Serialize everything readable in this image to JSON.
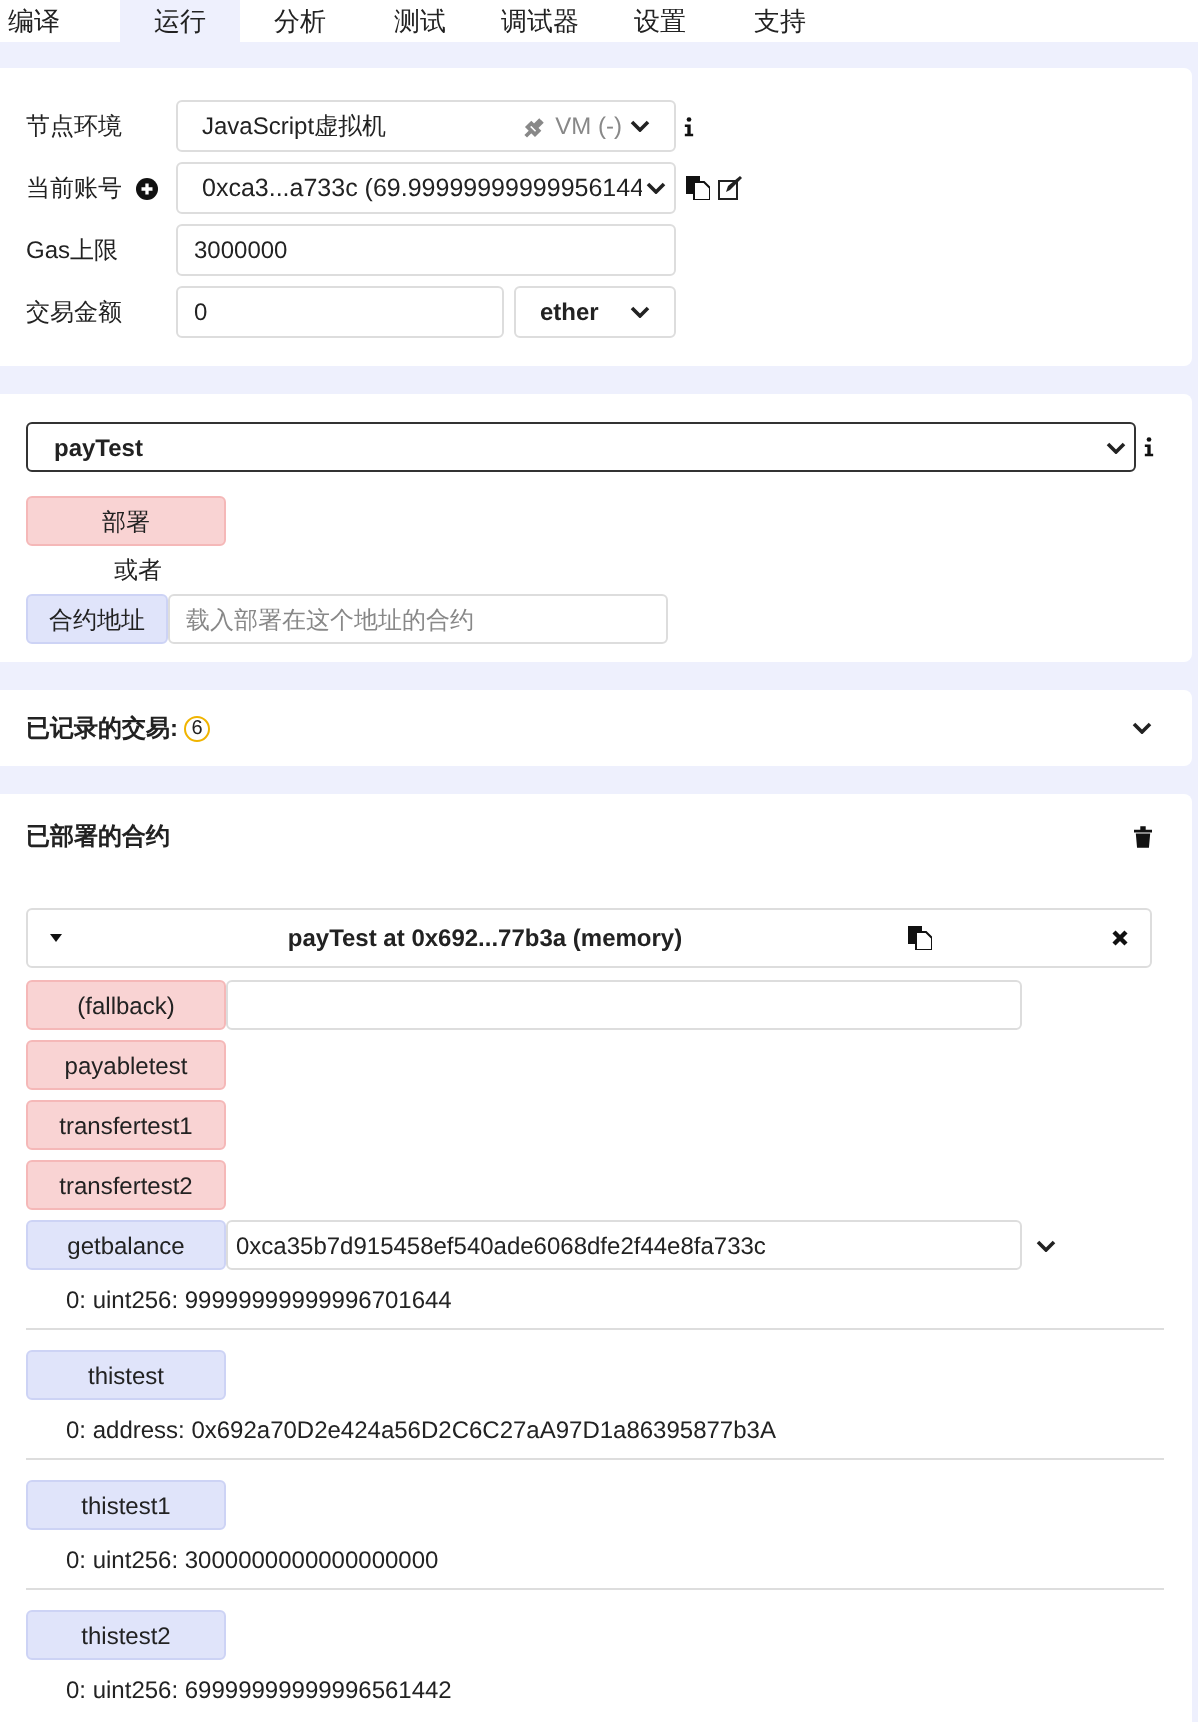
{
  "tabs": [
    {
      "label": "编译",
      "selected": false
    },
    {
      "label": "运行",
      "selected": true
    },
    {
      "label": "分析",
      "selected": false
    },
    {
      "label": "测试",
      "selected": false
    },
    {
      "label": "调试器",
      "selected": false
    },
    {
      "label": "设置",
      "selected": false
    },
    {
      "label": "支持",
      "selected": false
    }
  ],
  "settings": {
    "environment": {
      "label": "节点环境",
      "value": "JavaScript虚拟机",
      "network": "VM (-)"
    },
    "account": {
      "label": "当前账号",
      "value": "0xca3...a733c (69.99999999999956144"
    },
    "gas_limit": {
      "label": "Gas上限",
      "value": "3000000"
    },
    "value": {
      "label": "交易金额",
      "amount": "0",
      "unit": "ether"
    }
  },
  "deploy": {
    "contract": "payTest",
    "deploy_button": "部署",
    "or": "或者",
    "at_address_button": "合约地址",
    "address_placeholder": "载入部署在这个地址的合约"
  },
  "recorded": {
    "title": "已记录的交易:",
    "count": "6",
    "expanded": false
  },
  "deployed": {
    "title": "已部署的合约",
    "instance": {
      "title": "payTest at 0x692...77b3a (memory)",
      "expanded": true,
      "functions": [
        {
          "kind": "transact",
          "name": "(fallback)",
          "argument_field": true
        },
        {
          "kind": "transact",
          "name": "payabletest"
        },
        {
          "kind": "transact",
          "name": "transfertest1"
        },
        {
          "kind": "transact",
          "name": "transfertest2"
        },
        {
          "kind": "call",
          "name": "getbalance",
          "input": "0xca35b7d915458ef540ade6068dfe2f44e8fa733c",
          "output": "0: uint256: 99999999999996701644"
        },
        {
          "kind": "call",
          "name": "thistest",
          "output": "0: address: 0x692a70D2e424a56D2C6C27aA97D1a86395877b3A"
        },
        {
          "kind": "call",
          "name": "thistest1",
          "output": "0: uint256: 3000000000000000000"
        },
        {
          "kind": "call",
          "name": "thistest2",
          "output": "0: uint256: 69999999999996561442"
        }
      ]
    }
  }
}
